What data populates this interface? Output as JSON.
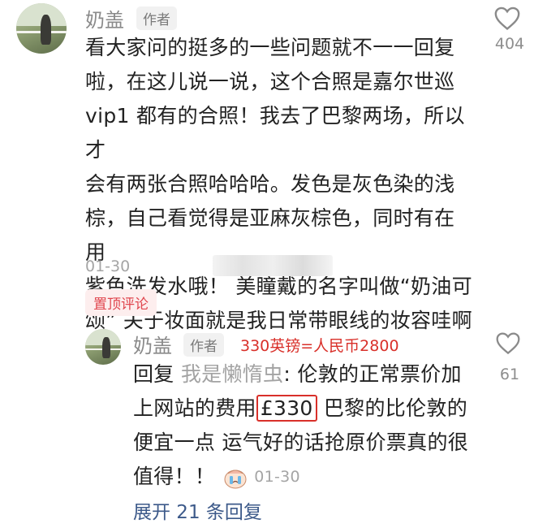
{
  "comment1": {
    "username": "奶盖",
    "author_tag": "作者",
    "text_lines": [
      "看大家问的挺多的一些问题就不一一回复",
      "啦，在这儿说一说，这个合照是嘉尔世巡",
      "vip1 都有的合照！我去了巴黎两场，所以才",
      "会有两张合照哈哈哈。发色是灰色染的浅",
      "棕，自己看觉得是亚麻灰棕色，同时有在用",
      "紫色洗发水哦！ 美瞳戴的名字叫做“奶油可",
      "颂” 关于妆面就是我日常带眼线的妆容哇啊"
    ],
    "date": "01-30",
    "like_count": "404",
    "like_icon": "heart-outline-icon",
    "pinned_label": "置顶评论"
  },
  "comment2": {
    "username": "奶盖",
    "author_tag": "作者",
    "annotation": "330英镑=人民币2800",
    "line1_prefix": "回复 ",
    "line1_reply_to": "我是懒惰虫",
    "line1_rest": ": 伦敦的正常票价加",
    "line2_before": "上网站的费用",
    "line2_highlight": "£330",
    "line2_after": " 巴黎的比伦敦的",
    "line3": "便宜一点 运气好的话抢原价票真的很",
    "line4": "值得！！",
    "emoji_icon": "crying-sticker-icon",
    "date": "01-30",
    "like_count": "61",
    "like_icon": "heart-outline-icon"
  },
  "expand_replies": "展开 21 条回复",
  "colors": {
    "annotation_red": "#d9302a",
    "pinned_red": "#e0464e",
    "link_blue": "#3d5a8a"
  }
}
